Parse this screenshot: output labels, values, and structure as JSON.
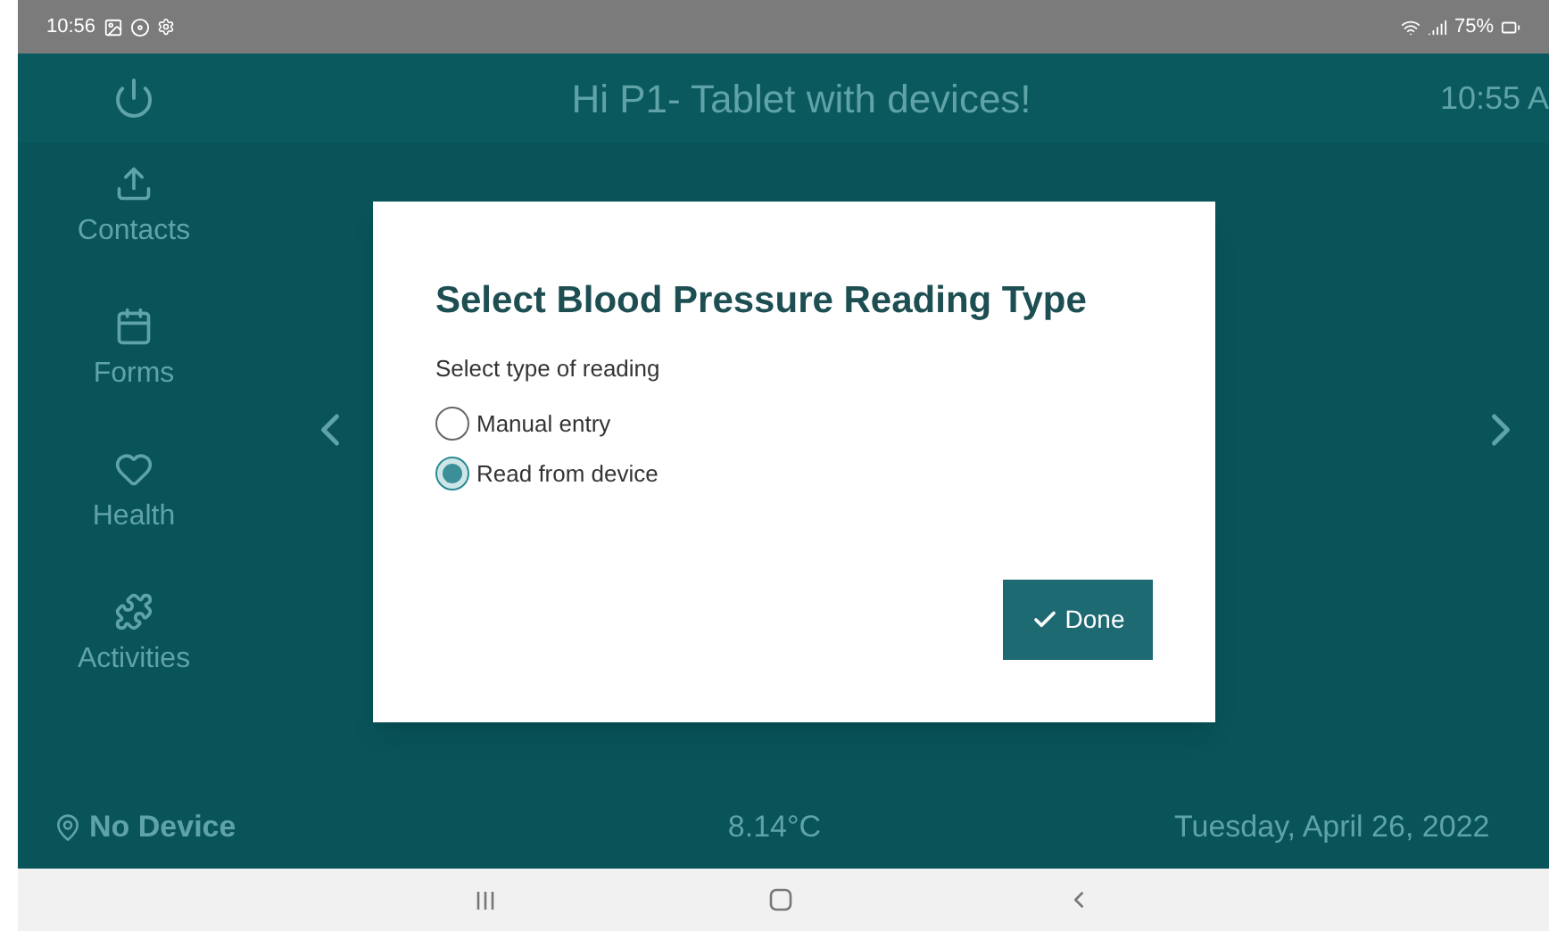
{
  "status_bar": {
    "time": "10:56",
    "battery": "75%"
  },
  "header": {
    "title": "Hi P1- Tablet with devices!",
    "time": "10:55 A"
  },
  "sidebar": {
    "items": [
      {
        "label": "Contacts",
        "kind": "contacts"
      },
      {
        "label": "Forms",
        "kind": "forms"
      },
      {
        "label": "Health",
        "kind": "health"
      },
      {
        "label": "Activities",
        "kind": "activities"
      }
    ]
  },
  "footer": {
    "device": "No Device",
    "temperature": "8.14°C",
    "date": "Tuesday, April 26, 2022"
  },
  "dialog": {
    "title": "Select Blood Pressure Reading Type",
    "prompt": "Select type of reading",
    "options": [
      {
        "label": "Manual entry",
        "selected": false
      },
      {
        "label": "Read from device",
        "selected": true
      }
    ],
    "button": "Done"
  }
}
